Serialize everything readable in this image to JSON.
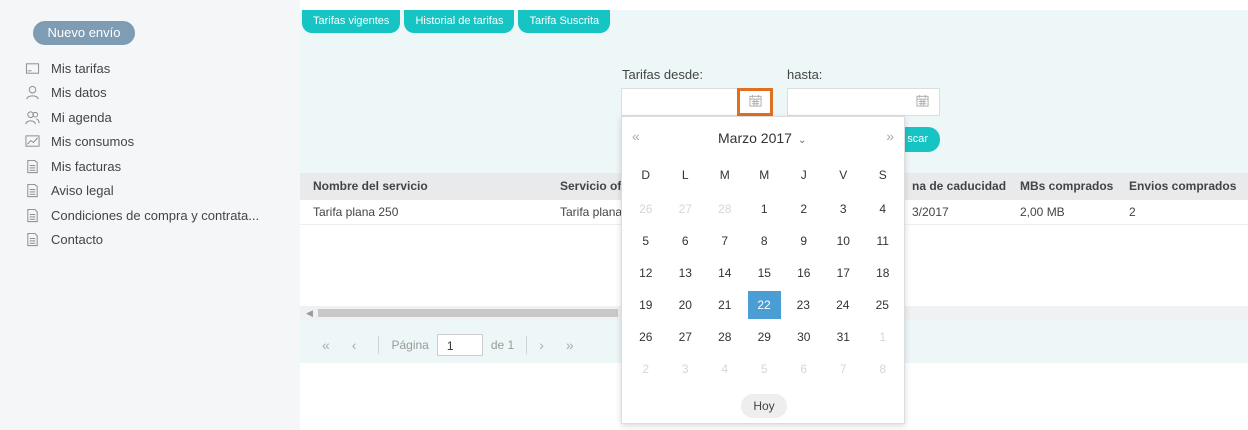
{
  "sidebar": {
    "new_button": "Nuevo envío",
    "items": [
      {
        "label": "Mis tarifas",
        "icon": "card-icon"
      },
      {
        "label": "Mis datos",
        "icon": "user-icon"
      },
      {
        "label": "Mi agenda",
        "icon": "contacts-icon"
      },
      {
        "label": "Mis consumos",
        "icon": "chart-icon"
      },
      {
        "label": "Mis facturas",
        "icon": "document-icon"
      },
      {
        "label": "Aviso legal",
        "icon": "document-icon"
      },
      {
        "label": "Condiciones de compra y contrata...",
        "icon": "document-icon"
      },
      {
        "label": "Contacto",
        "icon": "document-icon"
      }
    ]
  },
  "tabs": [
    "Tarifas vigentes",
    "Historial de tarifas",
    "Tarifa Suscrita"
  ],
  "filter": {
    "desde_label": "Tarifas desde:",
    "hasta_label": "hasta:",
    "desde_value": "",
    "hasta_value": "",
    "search_label": "scar"
  },
  "table": {
    "headers": [
      "Nombre del servicio",
      "Servicio ofr",
      "na de caducidad",
      "MBs comprados",
      "Envios comprados"
    ],
    "rows": [
      [
        "Tarifa plana 250",
        "Tarifa plana",
        "3/2017",
        "2,00 MB",
        "2"
      ]
    ]
  },
  "pager": {
    "first": "«",
    "prev": "‹",
    "page_label": "Página",
    "page_value": "1",
    "of_label": "de 1",
    "next": "›",
    "last": "»"
  },
  "calendar": {
    "prev": "«",
    "next": "»",
    "title": "Marzo 2017",
    "chevron": "⌄",
    "dow": [
      "D",
      "L",
      "M",
      "M",
      "J",
      "V",
      "S"
    ],
    "weeks": [
      [
        "26",
        "27",
        "28",
        "1",
        "2",
        "3",
        "4"
      ],
      [
        "5",
        "6",
        "7",
        "8",
        "9",
        "10",
        "11"
      ],
      [
        "12",
        "13",
        "14",
        "15",
        "16",
        "17",
        "18"
      ],
      [
        "19",
        "20",
        "21",
        "22",
        "23",
        "24",
        "25"
      ],
      [
        "26",
        "27",
        "28",
        "29",
        "30",
        "31",
        "1"
      ],
      [
        "2",
        "3",
        "4",
        "5",
        "6",
        "7",
        "8"
      ]
    ],
    "selected": "22",
    "today_button": "Hoy"
  },
  "colors": {
    "accent": "#17c4c4",
    "sidebar_button": "#7e9cb3",
    "selected_day": "#4a9ed4",
    "focus_outline": "#e0701e"
  }
}
